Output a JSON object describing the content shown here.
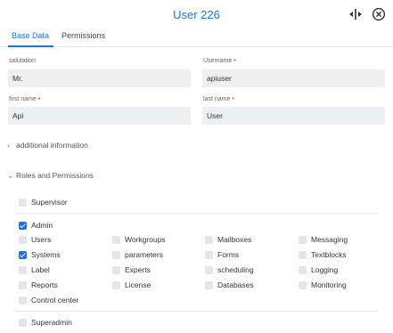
{
  "header": {
    "title": "User 226"
  },
  "tabs": [
    {
      "label": "Base Data"
    },
    {
      "label": "Permissions"
    }
  ],
  "form": {
    "salutation": {
      "label": "salutation",
      "value": "Mr."
    },
    "username": {
      "label": "Username",
      "value": "apiuser",
      "required_mark": "•"
    },
    "first_name": {
      "label": "first name",
      "value": "Api",
      "required_mark": "•"
    },
    "last_name": {
      "label": "last name",
      "value": "User",
      "required_mark": "•"
    }
  },
  "sections": {
    "additional": {
      "label": "additional information",
      "expanded": false
    },
    "roles": {
      "label": "Roles and Permissions",
      "expanded": true
    }
  },
  "roles": {
    "supervisor": {
      "label": "Supervisor",
      "checked": false
    },
    "admin": {
      "label": "Admin",
      "checked": true
    },
    "grid": [
      [
        {
          "label": "Users",
          "checked": false
        },
        {
          "label": "Workgroups",
          "checked": false
        },
        {
          "label": "Mailboxes",
          "checked": false
        },
        {
          "label": "Messaging",
          "checked": false
        }
      ],
      [
        {
          "label": "Systems",
          "checked": true
        },
        {
          "label": "parameters",
          "checked": false
        },
        {
          "label": "Forms",
          "checked": false
        },
        {
          "label": "Textblocks",
          "checked": false
        }
      ],
      [
        {
          "label": "Label",
          "checked": false
        },
        {
          "label": "Experts",
          "checked": false
        },
        {
          "label": "scheduling",
          "checked": false
        },
        {
          "label": "Logging",
          "checked": false
        }
      ],
      [
        {
          "label": "Reports",
          "checked": false
        },
        {
          "label": "License",
          "checked": false
        },
        {
          "label": "Databases",
          "checked": false
        },
        {
          "label": "Monitoring",
          "checked": false
        }
      ]
    ],
    "control_center": {
      "label": "Control center",
      "checked": false
    },
    "superadmin": {
      "label": "Superadmin",
      "checked": false
    }
  },
  "icons": {
    "split": "split-view-icon",
    "close": "close-icon"
  },
  "colors": {
    "accent": "#1a73e8",
    "required": "#e53935",
    "input_bg": "#edf0f3"
  }
}
